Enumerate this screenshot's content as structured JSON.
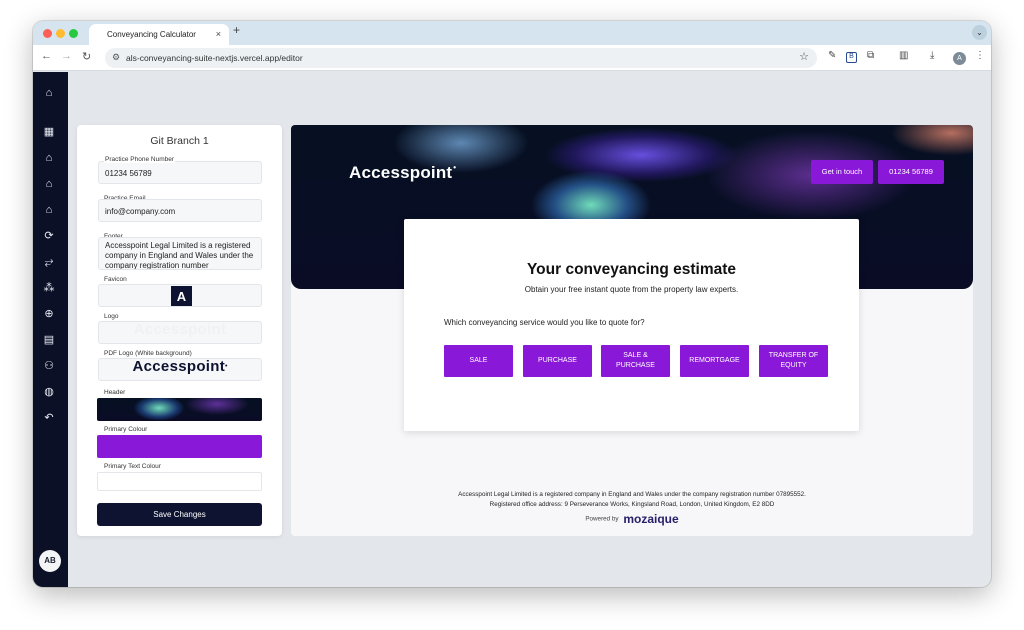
{
  "browser": {
    "tab_title": "Conveyancing Calculator",
    "tab_close": "×",
    "new_tab": "+",
    "tab_menu": "⌄",
    "url": "als-conveyancing-suite-nextjs.vercel.app/editor",
    "profile_initial": "A"
  },
  "sidebar": {
    "icons": [
      "home-icon",
      "dashboard-icon",
      "house-icon",
      "house-plus-icon",
      "house-outline-icon",
      "refresh-icon",
      "route-icon",
      "org-icon",
      "plus-circle-icon",
      "document-icon",
      "users-icon",
      "globe-icon",
      "undo-icon"
    ],
    "avatar": "AB"
  },
  "editor": {
    "title": "Git Branch 1",
    "phone_label": "Practice Phone Number",
    "phone_value": "01234 56789",
    "email_label": "Practice Email",
    "email_value": "info@company.com",
    "footer_label": "Footer",
    "footer_value": "Accesspoint Legal Limited is a registered company in England and Wales under the company registration number",
    "favicon_label": "Favicon",
    "favicon_letter": "A",
    "logo_label": "Logo",
    "logo_text": "Accesspoint",
    "pdf_logo_label": "PDF Logo (White background)",
    "pdf_logo_text": "Accesspoint",
    "header_label": "Header",
    "primary_colour_label": "Primary Colour",
    "primary_colour": "#8a18d8",
    "primary_text_colour_label": "Primary Text Colour",
    "primary_text_colour": "#ffffff",
    "save_label": "Save Changes"
  },
  "preview": {
    "brand": "Accesspoint",
    "get_in_touch": "Get in touch",
    "phone": "01234 56789",
    "card_title": "Your conveyancing estimate",
    "card_subtitle": "Obtain your free instant quote from the property law experts.",
    "question": "Which conveyancing service would you like to quote for?",
    "services": [
      "SALE",
      "PURCHASE",
      "SALE & PURCHASE",
      "REMORTGAGE",
      "TRANSFER OF EQUITY"
    ],
    "footer_line1": "Accesspoint Legal Limited is a registered company in England and Wales under the company registration number 07895552.",
    "footer_line2": "Registered office address: 9 Perseverance Works, Kingsland Road, London, United Kingdom, E2 8DD",
    "powered_by": "Powered by",
    "powered_brand": "mozaique"
  }
}
